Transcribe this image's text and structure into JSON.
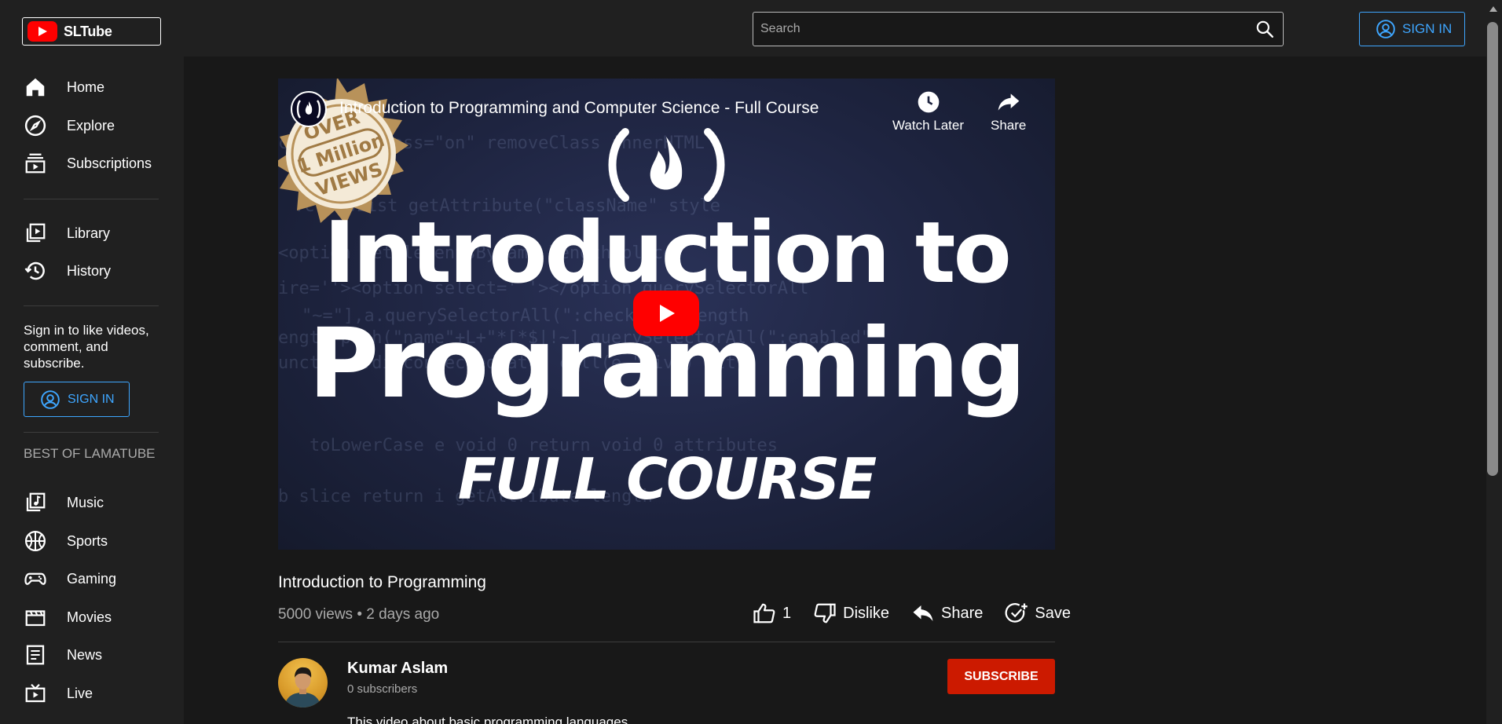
{
  "brand": {
    "name": "SLTube",
    "accent": "#ff0000",
    "link_color": "#3ea6ff"
  },
  "search": {
    "placeholder": "Search"
  },
  "header": {
    "signin_label": "SIGN IN"
  },
  "sidebar": {
    "main_items": [
      {
        "label": "Home",
        "icon": "home-icon"
      },
      {
        "label": "Explore",
        "icon": "compass-icon"
      },
      {
        "label": "Subscriptions",
        "icon": "subscriptions-icon"
      }
    ],
    "library_items": [
      {
        "label": "Library",
        "icon": "library-icon"
      },
      {
        "label": "History",
        "icon": "history-icon"
      }
    ],
    "signin_prompt": "Sign in to like videos, comment, and subscribe.",
    "signin_label": "SIGN IN",
    "section_title": "BEST OF LAMATUBE",
    "best_items": [
      {
        "label": "Music",
        "icon": "music-icon"
      },
      {
        "label": "Sports",
        "icon": "sports-icon"
      },
      {
        "label": "Gaming",
        "icon": "gamepad-icon"
      },
      {
        "label": "Movies",
        "icon": "movies-icon"
      },
      {
        "label": "News",
        "icon": "news-icon"
      },
      {
        "label": "Live",
        "icon": "live-icon"
      }
    ]
  },
  "player": {
    "embed_title": "Introduction to Programming and Computer Science - Full Course",
    "watch_later_label": "Watch Later",
    "share_label": "Share",
    "thumbnail": {
      "badge_top": "OVER",
      "badge_mid": "1 Million",
      "badge_bottom": "VIEWS",
      "line1": "Introduction to",
      "line2": "Programming",
      "line3": "FULL COURSE"
    }
  },
  "video": {
    "title": "Introduction to Programming",
    "meta": "5000 views • 2 days ago",
    "likes": "1",
    "dislike_label": "Dislike",
    "share_label": "Share",
    "save_label": "Save",
    "description": "This video about basic programming languages"
  },
  "channel": {
    "name": "Kumar Aslam",
    "subscribers": "0 subscribers",
    "subscribe_label": "SUBSCRIBE",
    "subscribe_color": "#cc1a00"
  }
}
